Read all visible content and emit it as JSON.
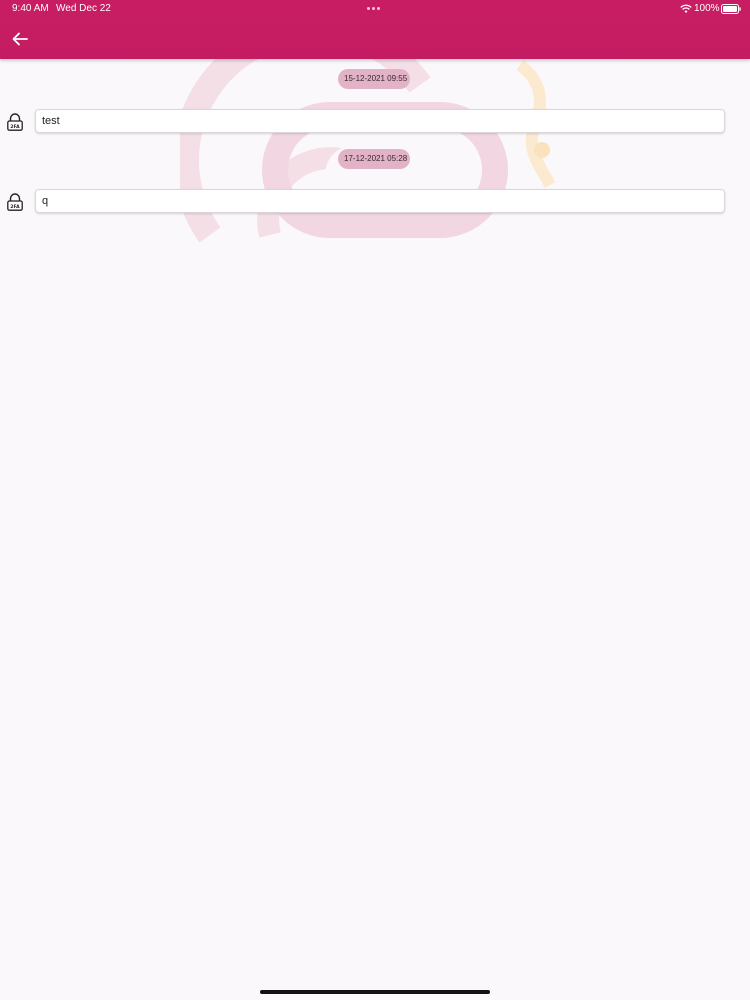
{
  "status_bar": {
    "time": "9:40 AM",
    "date": "Wed Dec 22",
    "battery": "100%"
  },
  "header": {
    "back_icon": "arrow-left-icon",
    "color": "#c81d63"
  },
  "messages": [
    {
      "date": "15-12-2021 09:55",
      "text": "test",
      "icon": "lock-2fa-icon",
      "icon_label": "2FA"
    },
    {
      "date": "17-12-2021 05:28",
      "text": "q",
      "icon": "lock-2fa-icon",
      "icon_label": "2FA"
    }
  ]
}
